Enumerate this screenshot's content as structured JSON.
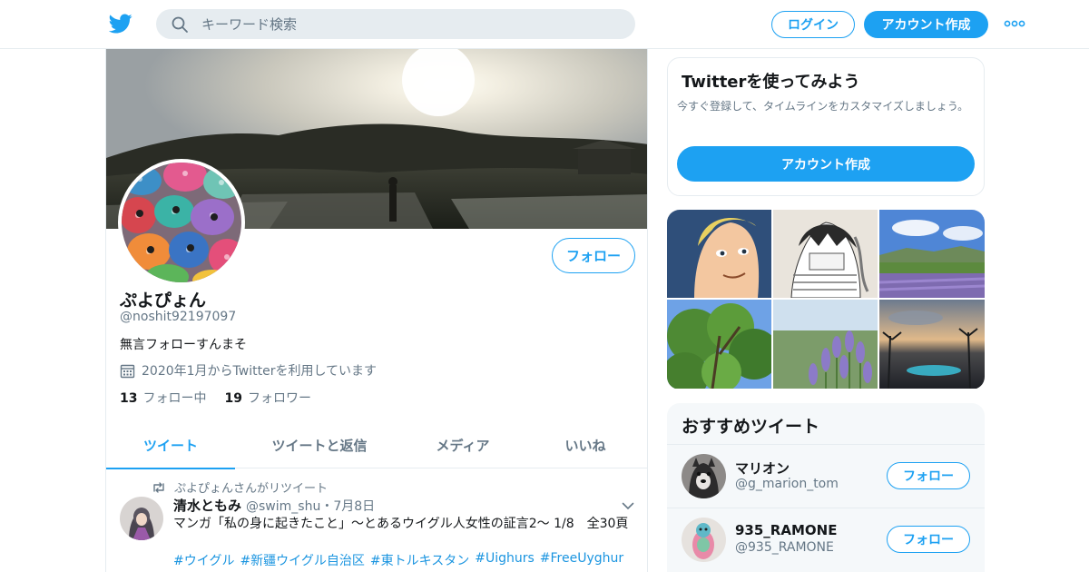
{
  "header": {
    "logo_icon": "twitter-bird-icon",
    "search_placeholder": "キーワード検索",
    "login_label": "ログイン",
    "signup_label": "アカウント作成",
    "more_icon": "more-dots-icon",
    "accent": "#1da1f2"
  },
  "profile": {
    "display_name": "ぷよぴょん",
    "handle": "@noshit92197097",
    "bio": "無言フォローすんまそ",
    "joined": "2020年1月からTwitterを利用しています",
    "following_count": "13",
    "following_label": "フォロー中",
    "followers_count": "19",
    "followers_label": "フォロワー",
    "follow_label": "フォロー"
  },
  "tabs": [
    {
      "label": "ツイート",
      "active": true
    },
    {
      "label": "ツイートと返信",
      "active": false
    },
    {
      "label": "メディア",
      "active": false
    },
    {
      "label": "いいね",
      "active": false
    }
  ],
  "tweet": {
    "retweet_text": "ぷよぴょんさんがリツイート",
    "author_name": "清水ともみ",
    "author_meta": "@swim_shu・7月8日",
    "text": "マンガ「私の身に起きたこと」～とあるウイグル人女性の証言2～ 1/8　全30頁",
    "hashtags": [
      "#ウイグル",
      "#新疆ウイグル自治区",
      "#東トルキスタン",
      "#Uighurs",
      "#FreeUyghur"
    ]
  },
  "sidebar": {
    "signup_card": {
      "title": "Twitterを使ってみよう",
      "description": "今すぐ登録して、タイムラインをカスタマイズしましょう。",
      "button_label": "アカウント作成"
    },
    "recommendations": {
      "title": "おすすめツイート",
      "items": [
        {
          "name": "マリオン",
          "handle": "@g_marion_tom",
          "button": "フォロー"
        },
        {
          "name": "935_RAMONE",
          "handle": "@935_RAMONE",
          "button": "フォロー"
        }
      ]
    }
  }
}
